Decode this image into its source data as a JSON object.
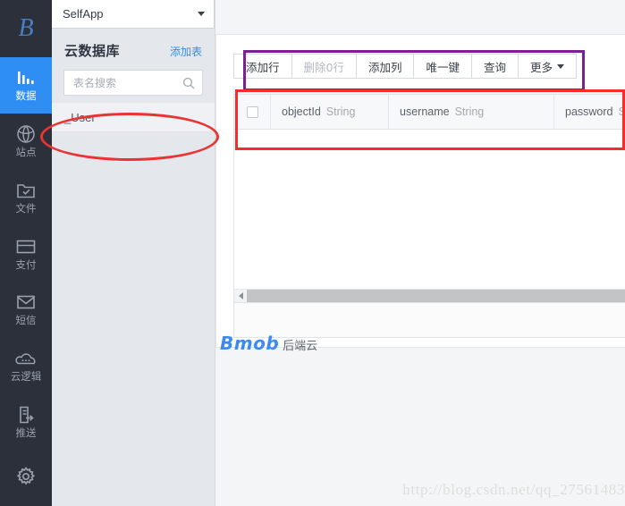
{
  "rail": {
    "logo": "B",
    "items": [
      {
        "label": "数据",
        "icon": "chart-bars-icon",
        "active": true
      },
      {
        "label": "站点",
        "icon": "globe-icon",
        "active": false
      },
      {
        "label": "文件",
        "icon": "folder-check-icon",
        "active": false
      },
      {
        "label": "支付",
        "icon": "credit-card-icon",
        "active": false
      },
      {
        "label": "短信",
        "icon": "envelope-icon",
        "active": false
      },
      {
        "label": "云逻辑",
        "icon": "cloud-dots-icon",
        "active": false
      },
      {
        "label": "推送",
        "icon": "push-document-icon",
        "active": false
      },
      {
        "label": "",
        "icon": "gear-icon",
        "active": false
      }
    ]
  },
  "app_select": {
    "name": "SelfApp",
    "caret": "chevron-down-icon"
  },
  "list_panel": {
    "title": "云数据库",
    "add_table_label": "添加表",
    "search": {
      "value": "",
      "placeholder": "表名搜索",
      "icon": "search-icon"
    },
    "tables": [
      {
        "name": "_User"
      }
    ]
  },
  "toolbar": {
    "buttons": [
      {
        "label": "添加行",
        "disabled": false,
        "caret": false
      },
      {
        "label": "删除0行",
        "disabled": true,
        "caret": false
      },
      {
        "label": "添加列",
        "disabled": false,
        "caret": false
      },
      {
        "label": "唯一键",
        "disabled": false,
        "caret": false
      },
      {
        "label": "查询",
        "disabled": false,
        "caret": false
      },
      {
        "label": "更多",
        "disabled": false,
        "caret": true
      }
    ]
  },
  "grid": {
    "select_all_checkbox": "unchecked",
    "columns": [
      {
        "name": "objectId",
        "type": "String"
      },
      {
        "name": "username",
        "type": "String"
      },
      {
        "name": "password",
        "type": "String"
      }
    ],
    "rows": [],
    "scrollbar": {
      "left_arrow": "triangle-left-icon"
    }
  },
  "branding": {
    "name": "Bmob",
    "suffix": "后端云"
  },
  "watermark": {
    "text": "http://blog.csdn.net/qq_27561483"
  },
  "annotations": {
    "toolbar_highlight_color": "#7b1f91",
    "grid_header_highlight_color": "#fa2b2b",
    "table_item_ellipse_color": "#ea3333"
  }
}
